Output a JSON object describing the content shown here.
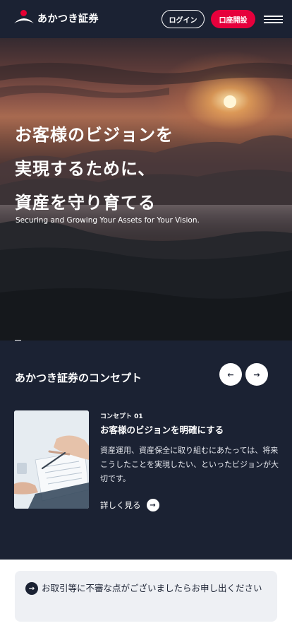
{
  "header": {
    "logo_text": "あかつき証券",
    "login_label": "ログイン",
    "open_account_label": "口座開設"
  },
  "hero": {
    "title_lines": [
      "お客様のビジョンを",
      "実現するために、",
      "資産を守り育てる"
    ],
    "subtitle": "Securing and Growing Your Assets for Your Vision."
  },
  "concept": {
    "section_title": "あかつき証券のコンセプト",
    "item": {
      "number": "コンセプト 01",
      "heading": "お客様のビジョンを明確にする",
      "body": "資産運用、資産保全に取り組むにあたっては、将来こうしたことを実現したい、といったビジョンが大切です。",
      "more_label": "詳しく見る"
    }
  },
  "notice": {
    "text": "お取引等に不審な点がございましたらお申し出ください"
  },
  "colors": {
    "navy": "#1b2233",
    "accent_red": "#e6003c"
  },
  "icons": {
    "prev": "arrow-left-icon",
    "next": "arrow-right-icon",
    "menu": "hamburger-menu-icon"
  }
}
